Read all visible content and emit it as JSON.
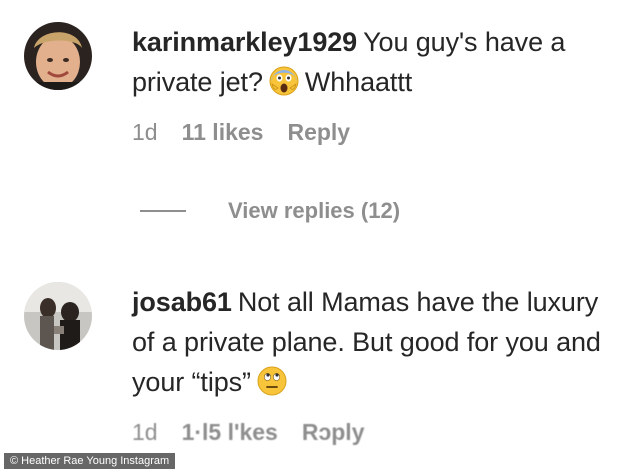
{
  "comments": [
    {
      "username": "karinmarkley1929",
      "text_before_emoji": "You guy's have a private jet?",
      "emoji": "screaming-face-emoji",
      "text_after_emoji": "Whhaattt",
      "time": "1d",
      "likes": "11 likes",
      "reply": "Reply"
    },
    {
      "username": "josab61",
      "text_before_emoji": "Not all Mamas have the luxury of a private plane. But good for you and your “tips”",
      "emoji": "eye-roll-emoji",
      "text_after_emoji": "",
      "time": "1d",
      "likes": "1·l5 l'kes",
      "reply": "Rɔply"
    }
  ],
  "view_replies": "View replies (12)",
  "watermark": "© Heather Rae Young Instagram",
  "colors": {
    "text": "#262626",
    "muted": "#8e8e8e",
    "background": "#ffffff"
  }
}
